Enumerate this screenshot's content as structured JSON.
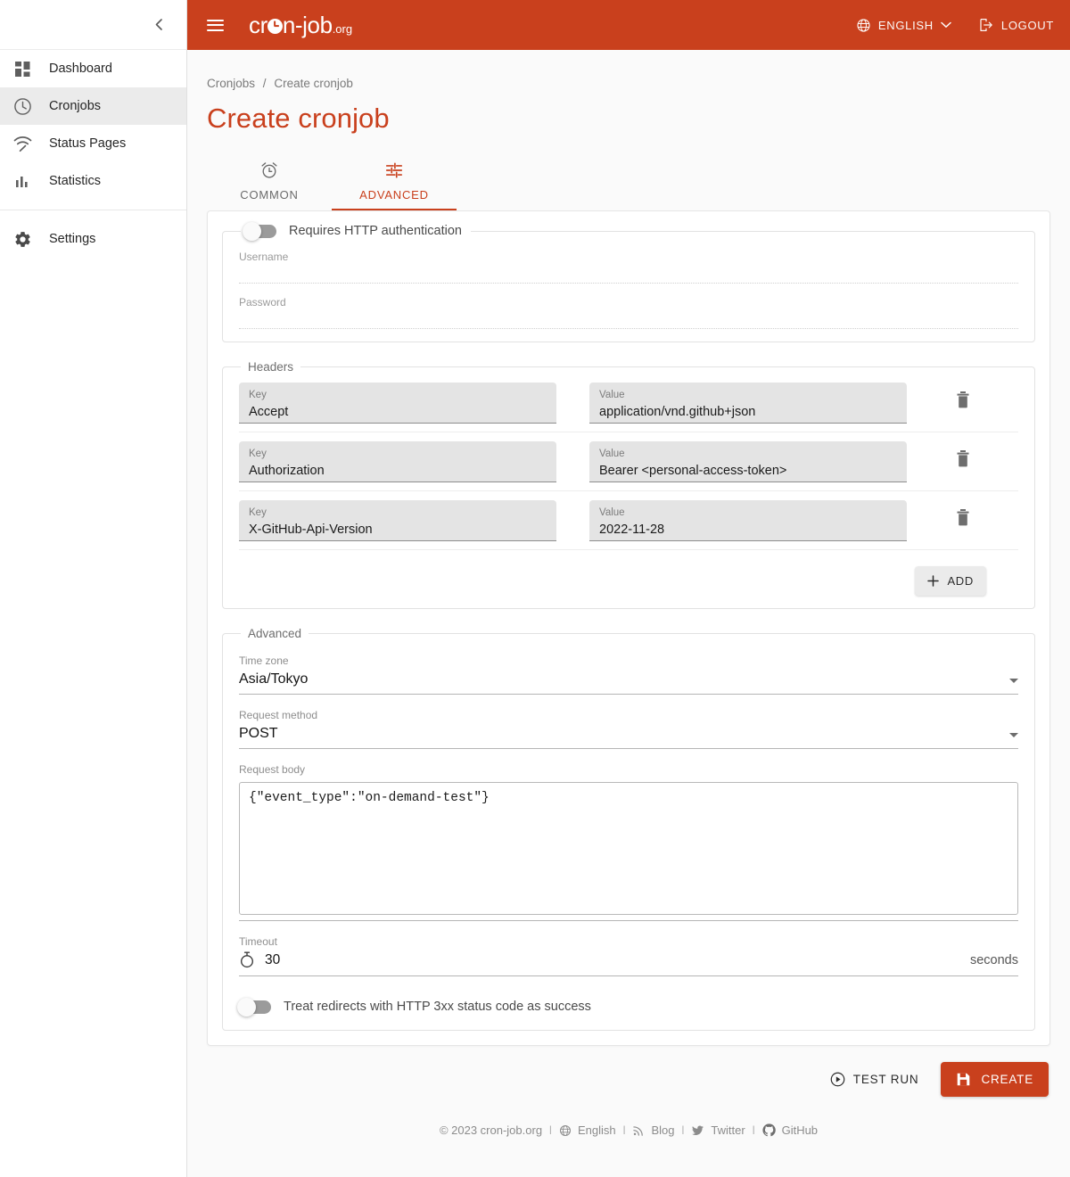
{
  "sidebar": {
    "collapse_label": "‹",
    "items": [
      {
        "label": "Dashboard",
        "icon": "dashboard-icon",
        "active": false
      },
      {
        "label": "Cronjobs",
        "icon": "clock-icon",
        "active": true
      },
      {
        "label": "Status Pages",
        "icon": "speed-icon",
        "active": false
      },
      {
        "label": "Statistics",
        "icon": "bar-chart-icon",
        "active": false
      },
      {
        "label": "Settings",
        "icon": "gear-icon",
        "active": false
      }
    ]
  },
  "topbar": {
    "menu_icon": "hamburger-icon",
    "brand_part1": "cr",
    "brand_part2": "n-job",
    "brand_tld": ".org",
    "language": "ENGLISH",
    "language_icon": "globe-icon",
    "language_caret": "chevron-down-icon",
    "logout": "LOGOUT",
    "logout_icon": "logout-icon"
  },
  "breadcrumb": {
    "parent": "Cronjobs",
    "separator": "/",
    "current": "Create cronjob"
  },
  "page": {
    "title": "Create cronjob"
  },
  "tabs": [
    {
      "label": "COMMON",
      "icon": "alarm-clock-icon",
      "active": false
    },
    {
      "label": "ADVANCED",
      "icon": "tune-icon",
      "active": true
    }
  ],
  "auth": {
    "legend": "Requires HTTP authentication",
    "enabled": false,
    "username_label": "Username",
    "username_value": "",
    "password_label": "Password",
    "password_value": ""
  },
  "headers": {
    "legend": "Headers",
    "key_label": "Key",
    "value_label": "Value",
    "rows": [
      {
        "key": "Accept",
        "value": "application/vnd.github+json",
        "delete_icon": "trash-icon"
      },
      {
        "key": "Authorization",
        "value": "Bearer <personal-access-token>",
        "delete_icon": "trash-icon"
      },
      {
        "key": "X-GitHub-Api-Version",
        "value": "2022-11-28",
        "delete_icon": "trash-icon"
      }
    ],
    "add_label": "ADD",
    "add_icon": "plus-icon"
  },
  "advanced": {
    "legend": "Advanced",
    "timezone_label": "Time zone",
    "timezone_value": "Asia/Tokyo",
    "method_label": "Request method",
    "method_value": "POST",
    "body_label": "Request body",
    "body_value": "{\"event_type\":\"on-demand-test\"}",
    "timeout_label": "Timeout",
    "timeout_value": "30",
    "timeout_icon": "stopwatch-icon",
    "timeout_suffix": "seconds",
    "redirects_label": "Treat redirects with HTTP 3xx status code as success",
    "redirects_enabled": false
  },
  "actions": {
    "test_run": "TEST RUN",
    "test_run_icon": "play-circle-icon",
    "create": "CREATE",
    "create_icon": "save-icon"
  },
  "footer": {
    "copyright": "© 2023 cron-job.org",
    "sep": "l",
    "language": "English",
    "language_icon": "globe-icon",
    "blog": "Blog",
    "blog_icon": "rss-icon",
    "twitter": "Twitter",
    "twitter_icon": "twitter-icon",
    "github": "GitHub",
    "github_icon": "github-icon"
  },
  "colors": {
    "accent": "#c9401d",
    "page_bg": "#fafafa",
    "sidebar_active": "#ebebeb"
  }
}
